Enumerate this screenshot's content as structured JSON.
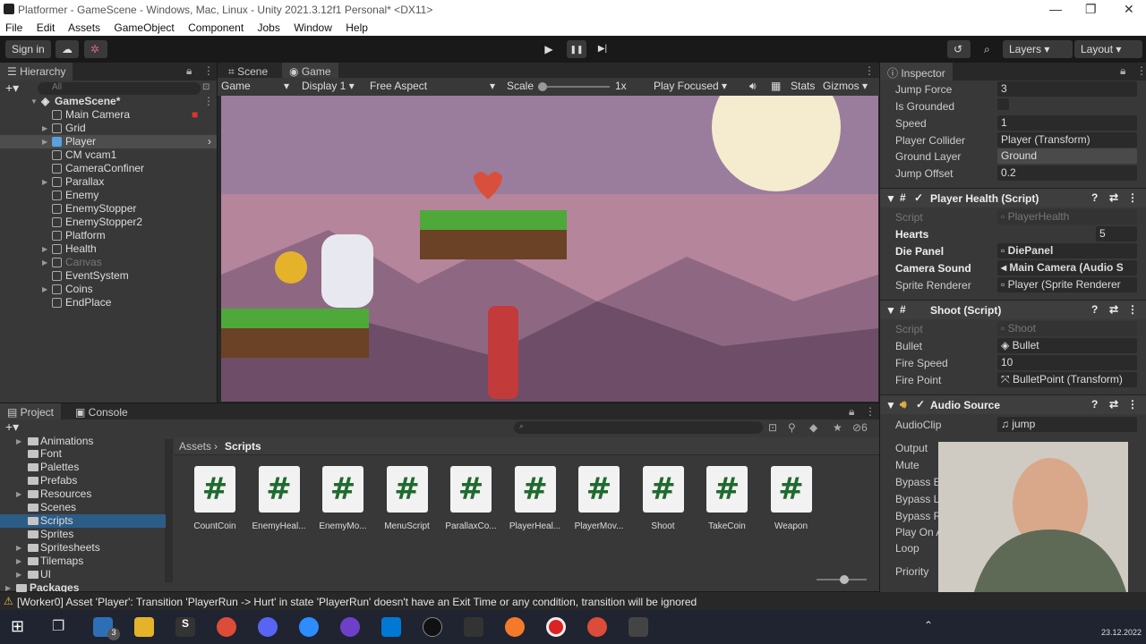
{
  "window": {
    "title": "Platformer - GameScene - Windows, Mac, Linux - Unity 2021.3.12f1 Personal* <DX11>",
    "controls": [
      "—",
      "❐",
      "✕"
    ]
  },
  "menu": [
    "File",
    "Edit",
    "Assets",
    "GameObject",
    "Component",
    "Jobs",
    "Window",
    "Help"
  ],
  "toolbar": {
    "sign_in": "Sign in",
    "play": "▶",
    "pause": "❚❚",
    "step": "▶|",
    "layers": "Layers",
    "layout": "Layout"
  },
  "hierarchy": {
    "tab": "Hierarchy",
    "search_placeholder": "All",
    "scene": "GameScene*",
    "items": [
      "Main Camera",
      "Grid",
      "Player",
      "CM vcam1",
      "CameraConfiner",
      "Parallax",
      "Enemy",
      "EnemyStopper",
      "EnemyStopper2",
      "Platform",
      "Health",
      "Canvas",
      "EventSystem",
      "Coins",
      "EndPlace"
    ]
  },
  "game_view": {
    "tabs": [
      "Scene",
      "Game"
    ],
    "display_mode": "Game",
    "display": "Display 1",
    "aspect": "Free Aspect",
    "scale_label": "Scale",
    "scale_value": "1x",
    "play_mode": "Play Focused",
    "stats": "Stats",
    "gizmos": "Gizmos"
  },
  "inspector": {
    "tab": "Inspector",
    "fields_top": [
      {
        "label": "Jump Force",
        "value": "3"
      },
      {
        "label": "Is Grounded",
        "value": ""
      },
      {
        "label": "Speed",
        "value": "1"
      },
      {
        "label": "Player Collider",
        "value": "Player (Transform)"
      },
      {
        "label": "Ground Layer",
        "value": "Ground"
      },
      {
        "label": "Jump Offset",
        "value": "0.2"
      }
    ],
    "player_health": {
      "title": "Player Health (Script)",
      "script": "PlayerHealth",
      "hearts_label": "Hearts",
      "hearts_value": "5",
      "die_panel_label": "Die Panel",
      "die_panel_value": "DiePanel",
      "camera_sound_label": "Camera Sound",
      "camera_sound_value": "Main Camera (Audio S",
      "sprite_renderer_label": "Sprite Renderer",
      "sprite_renderer_value": "Player (Sprite Renderer"
    },
    "shoot": {
      "title": "Shoot (Script)",
      "script": "Shoot",
      "bullet_label": "Bullet",
      "bullet_value": "Bullet",
      "fire_speed_label": "Fire Speed",
      "fire_speed_value": "10",
      "fire_point_label": "Fire Point",
      "fire_point_value": "BulletPoint (Transform)"
    },
    "audio": {
      "title": "Audio Source",
      "clip_label": "AudioClip",
      "clip_value": "jump",
      "output_label": "Output",
      "mute_label": "Mute",
      "bypass1": "Bypass E",
      "bypass2": "Bypass L",
      "bypass3": "Bypass R",
      "play_on": "Play On A",
      "loop": "Loop",
      "priority": "Priority"
    },
    "script_label": "Script"
  },
  "project": {
    "tabs": [
      "Project",
      "Console"
    ],
    "folders": [
      "Animations",
      "Font",
      "Palettes",
      "Prefabs",
      "Resources",
      "Scenes",
      "Scripts",
      "Sprites",
      "Spritesheets",
      "Tilemaps",
      "UI",
      "Packages"
    ],
    "breadcrumb_root": "Assets",
    "breadcrumb_current": "Scripts",
    "hidden_count": "6",
    "assets": [
      "CountCoin",
      "EnemyHeal...",
      "EnemyMo...",
      "MenuScript",
      "ParallaxCo...",
      "PlayerHeal...",
      "PlayerMov...",
      "Shoot",
      "TakeCoin",
      "Weapon"
    ]
  },
  "status": {
    "message": "[Worker0] Asset 'Player': Transition 'PlayerRun -> Hurt' in state 'PlayerRun' doesn't have an Exit Time or any condition, transition will be ignored"
  },
  "taskbar": {
    "date": "23.12.2022",
    "mail_badge": "3"
  },
  "colors": {
    "editor_bg": "#383838",
    "selection": "#2c5d87",
    "script_hash": "#1f6b2f"
  }
}
